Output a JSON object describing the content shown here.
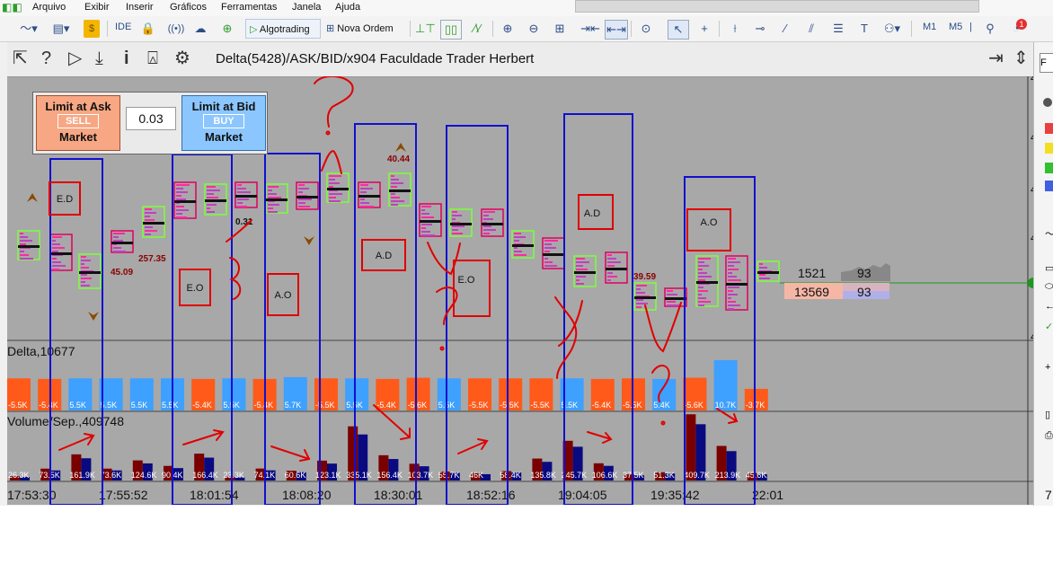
{
  "menu": [
    "Arquivo",
    "Exibir",
    "Inserir",
    "Gráficos",
    "Ferramentas",
    "Janela",
    "Ajuda"
  ],
  "toolbar": {
    "ide_label": "IDE",
    "algotrading_label": "Algotrading",
    "nova_ordem_label": "Nova Ordem",
    "m1_label": "M1",
    "m5_label": "M5",
    "notification_count": "1"
  },
  "chart": {
    "title": "Delta(5428)/ASK/BID/x904   Faculdade Trader Herbert",
    "trade_panel": {
      "ask_label": "Limit at Ask",
      "sell_label": "SELL",
      "sell_market_label": "Market",
      "lot": "0.03",
      "bid_label": "Limit at Bid",
      "buy_label": "BUY",
      "buy_market_label": "Market"
    },
    "price_labels": [
      "45.09",
      "257.35",
      "0.31",
      "40.44",
      "39.59"
    ],
    "box_labels": [
      "E.D",
      "E.O",
      "A.O",
      "A.D",
      "E.O",
      "A.D",
      "A.O"
    ],
    "side_table": {
      "r1c1": "1521",
      "r1c2": "93",
      "r2c1": "13569",
      "r2c2": "93"
    },
    "delta_label": "Delta,10677",
    "delta_values": [
      "-5.5K",
      "-5.4K",
      "5.5K",
      "5.5K",
      "5.5K",
      "5.5K",
      "-5.4K",
      "5.5K",
      "-5.4K",
      "5.7K",
      "-5.5K",
      "5.5K",
      "-5.4K",
      "-5.6K",
      "5.5K",
      "-5.5K",
      "-5.5K",
      "-5.5K",
      "5.5K",
      "-5.4K",
      "-5.5K",
      "5.4K",
      "-5.6K",
      "10.7K",
      "-3.7K"
    ],
    "volume_label": "Volume/Sep.,409748",
    "volume_values": [
      "26.3K",
      "73.5K",
      "161.9K",
      "73.6K",
      "124.6K",
      "90.4K",
      "166.4K",
      "23.3K",
      "74.1K",
      "60.6K",
      "123.1K",
      "335.1K",
      "156.4K",
      "103.7K",
      "55.7K",
      "46K",
      "58.4K",
      "135.8K",
      "245.7K",
      "106.6K",
      "37.5K",
      "51.3K",
      "409.7K",
      "213.9K",
      "45.6K"
    ],
    "time_labels": [
      "17:53:30",
      "17:55:52",
      "18:01:54",
      "18:08:20",
      "18:30:01",
      "18:52:16",
      "19:04:05",
      "19:35:42",
      "22:01"
    ],
    "scale_labels": [
      "4",
      "4",
      "4",
      "4",
      "4"
    ],
    "right_edge_label": "7",
    "colors": {
      "bg": "#a8a8a8",
      "buy": "#3ea0ff",
      "sell": "#ff5a1a",
      "bull_box": "#7cff3a",
      "bear_box": "#e00060",
      "annotation": "#ff0000",
      "frame": "#1010d0",
      "vol_red": "#7a0000",
      "vol_blue": "#0a0a80"
    }
  },
  "icons": [
    "chart-line-icon",
    "save-icon",
    "lock-icon",
    "radio-icon",
    "cloud-icon",
    "globe-icon",
    "play-icon",
    "plus-order-icon",
    "zoom-in-icon",
    "zoom-out-icon",
    "grid-icon",
    "cursor-icon",
    "crosshair-icon",
    "text-tool-icon",
    "search-icon",
    "bell-icon",
    "help-icon",
    "download-icon",
    "info-icon",
    "settings-icon",
    "scroll-icon"
  ]
}
